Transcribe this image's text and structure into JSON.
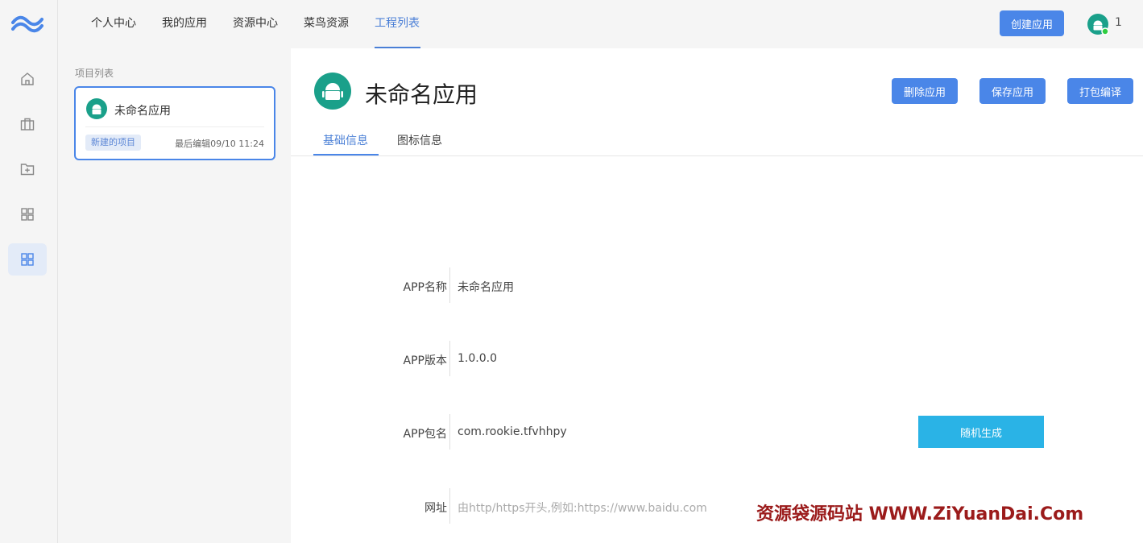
{
  "nav": {
    "items": [
      "个人中心",
      "我的应用",
      "资源中心",
      "菜鸟资源",
      "工程列表"
    ],
    "active_index": 4,
    "create_label": "创建应用",
    "user_count": "1"
  },
  "rail": {
    "icons": [
      "home-icon",
      "briefcase-icon",
      "folder-plus-icon",
      "grid-icon",
      "grid-icon"
    ],
    "active_index": 4
  },
  "project_list": {
    "title": "项目列表",
    "card": {
      "name": "未命名应用",
      "badge": "新建的项目",
      "time": "最后编辑09/10 11:24"
    }
  },
  "main": {
    "title": "未命名应用",
    "actions": [
      "删除应用",
      "保存应用",
      "打包编译"
    ],
    "tabs": [
      "基础信息",
      "图标信息"
    ],
    "active_tab": 0,
    "form": {
      "name_label": "APP名称",
      "name_value": "未命名应用",
      "version_label": "APP版本",
      "version_value": "1.0.0.0",
      "package_label": "APP包名",
      "package_value": "com.rookie.tfvhhpy",
      "random_label": "随机生成",
      "url_label": "网址",
      "url_placeholder": "由http/https开头,例如:https://www.baidu.com"
    }
  },
  "watermark": "资源袋源码站 WWW.ZiYuanDai.Com",
  "colors": {
    "accent": "#4a86e8",
    "random_button": "#2ab3e6",
    "android_green": "#1aa08a"
  }
}
